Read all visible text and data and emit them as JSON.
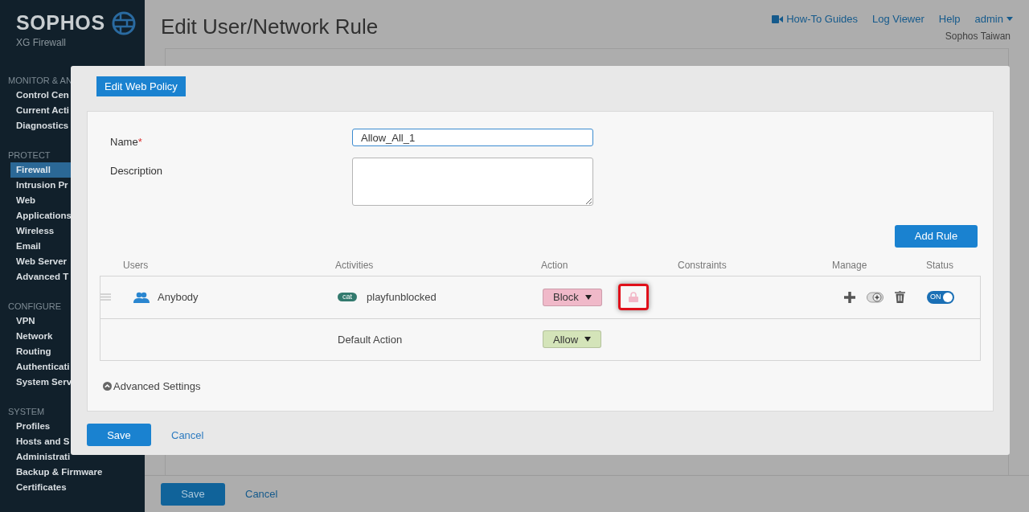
{
  "sidebar": {
    "logo": "SOPHOS",
    "product": "XG Firewall",
    "sections": [
      {
        "title": "MONITOR & AN",
        "items": [
          {
            "label": "Control Cen",
            "selected": false
          },
          {
            "label": "Current Acti",
            "selected": false
          },
          {
            "label": "Diagnostics",
            "selected": false
          }
        ]
      },
      {
        "title": "PROTECT",
        "items": [
          {
            "label": "Firewall",
            "selected": true
          },
          {
            "label": "Intrusion Pr",
            "selected": false
          },
          {
            "label": "Web",
            "selected": false
          },
          {
            "label": "Applications",
            "selected": false
          },
          {
            "label": "Wireless",
            "selected": false
          },
          {
            "label": "Email",
            "selected": false
          },
          {
            "label": "Web Server",
            "selected": false
          },
          {
            "label": "Advanced T",
            "selected": false
          }
        ]
      },
      {
        "title": "CONFIGURE",
        "items": [
          {
            "label": "VPN",
            "selected": false
          },
          {
            "label": "Network",
            "selected": false
          },
          {
            "label": "Routing",
            "selected": false
          },
          {
            "label": "Authenticati",
            "selected": false
          },
          {
            "label": "System Serv",
            "selected": false
          }
        ]
      },
      {
        "title": "SYSTEM",
        "items": [
          {
            "label": "Profiles",
            "selected": false
          },
          {
            "label": "Hosts and S",
            "selected": false
          },
          {
            "label": "Administrati",
            "selected": false
          },
          {
            "label": "Backup & Firmware",
            "selected": false
          },
          {
            "label": "Certificates",
            "selected": false
          }
        ]
      }
    ]
  },
  "header": {
    "title": "Edit User/Network Rule",
    "links": [
      {
        "label": "How-To Guides",
        "kind": "video"
      },
      {
        "label": "Log Viewer",
        "kind": "plain"
      },
      {
        "label": "Help",
        "kind": "plain"
      }
    ],
    "user": "admin",
    "org": "Sophos Taiwan"
  },
  "page_footer": {
    "save": "Save",
    "cancel": "Cancel"
  },
  "dialog": {
    "tab": "Edit Web Policy",
    "name_label": "Name",
    "required_mark": "*",
    "name_value": "Allow_All_1",
    "description_label": "Description",
    "add_rule": "Add Rule",
    "columns": [
      "Users",
      "Activities",
      "Action",
      "Constraints",
      "Manage",
      "Status"
    ],
    "rules": [
      {
        "user": "Anybody",
        "activity_tag": "cat",
        "activity": "playfunblocked",
        "action": "Block",
        "color": "#f0b9c9",
        "highlighted": true,
        "status_on": true,
        "status_label": "ON"
      }
    ],
    "default_action": {
      "label": "Default Action",
      "action": "Allow",
      "color": "#d4e4b9"
    },
    "advanced_label": "Advanced Settings",
    "save": "Save",
    "cancel": "Cancel"
  }
}
